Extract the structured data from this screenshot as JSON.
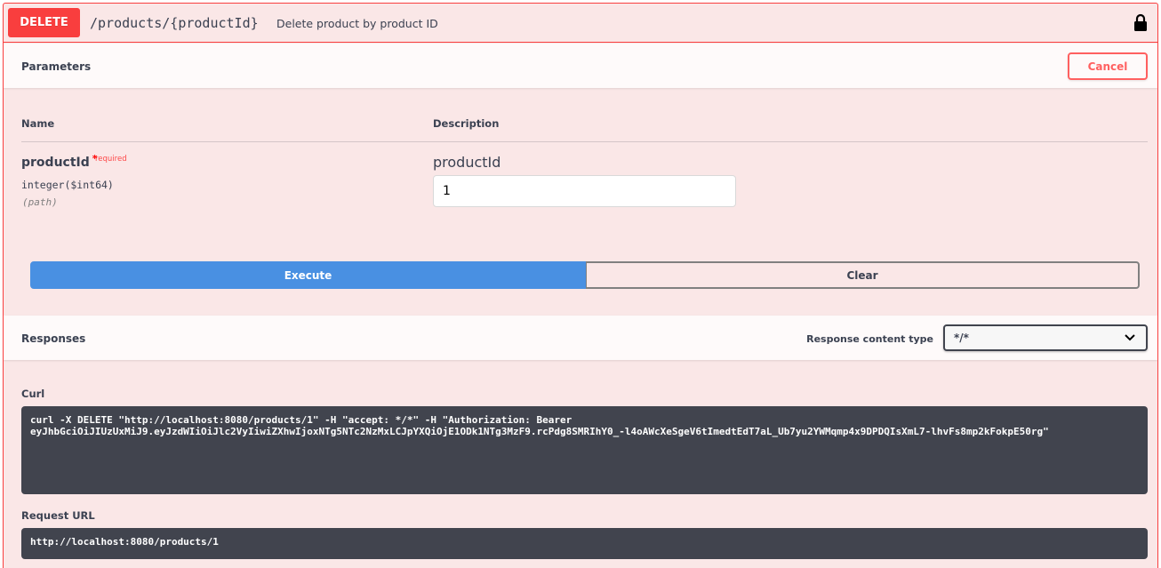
{
  "operation": {
    "method": "DELETE",
    "path": "/products/{productId}",
    "summary": "Delete product by product ID",
    "lock_icon": "lock-icon"
  },
  "parameters": {
    "title": "Parameters",
    "cancel_label": "Cancel",
    "columns": {
      "name": "Name",
      "description": "Description"
    },
    "items": [
      {
        "name": "productId",
        "required_mark": "*",
        "required_label": "required",
        "type": "integer($int64)",
        "in": "(path)",
        "description": "productId",
        "value": "1"
      }
    ]
  },
  "actions": {
    "execute_label": "Execute",
    "clear_label": "Clear"
  },
  "responses": {
    "title": "Responses",
    "content_type_label": "Response content type",
    "content_type_value": "*/*",
    "curl_label": "Curl",
    "curl_command": "curl -X DELETE \"http://localhost:8080/products/1\" -H \"accept: */*\" -H \"Authorization: Bearer\neyJhbGciOiJIUzUxMiJ9.eyJzdWIiOiJlc2VyIiwiZXhwIjoxNTg5NTc2NzMxLCJpYXQiOjE1ODk1NTg3MzF9.rcPdg8SMRIhY0_-l4oAWcXeSgeV6tImedtEdT7aL_Ub7yu2YWMqmp4x9DPDQIsXmL7-lhvFs8mp2kFokpE50rg\"",
    "request_url_label": "Request URL",
    "request_url": "http://localhost:8080/products/1"
  },
  "colors": {
    "delete": "#f93e3e",
    "block_bg": "#fae7e7",
    "execute": "#4990e2",
    "code_bg": "#41444e"
  }
}
